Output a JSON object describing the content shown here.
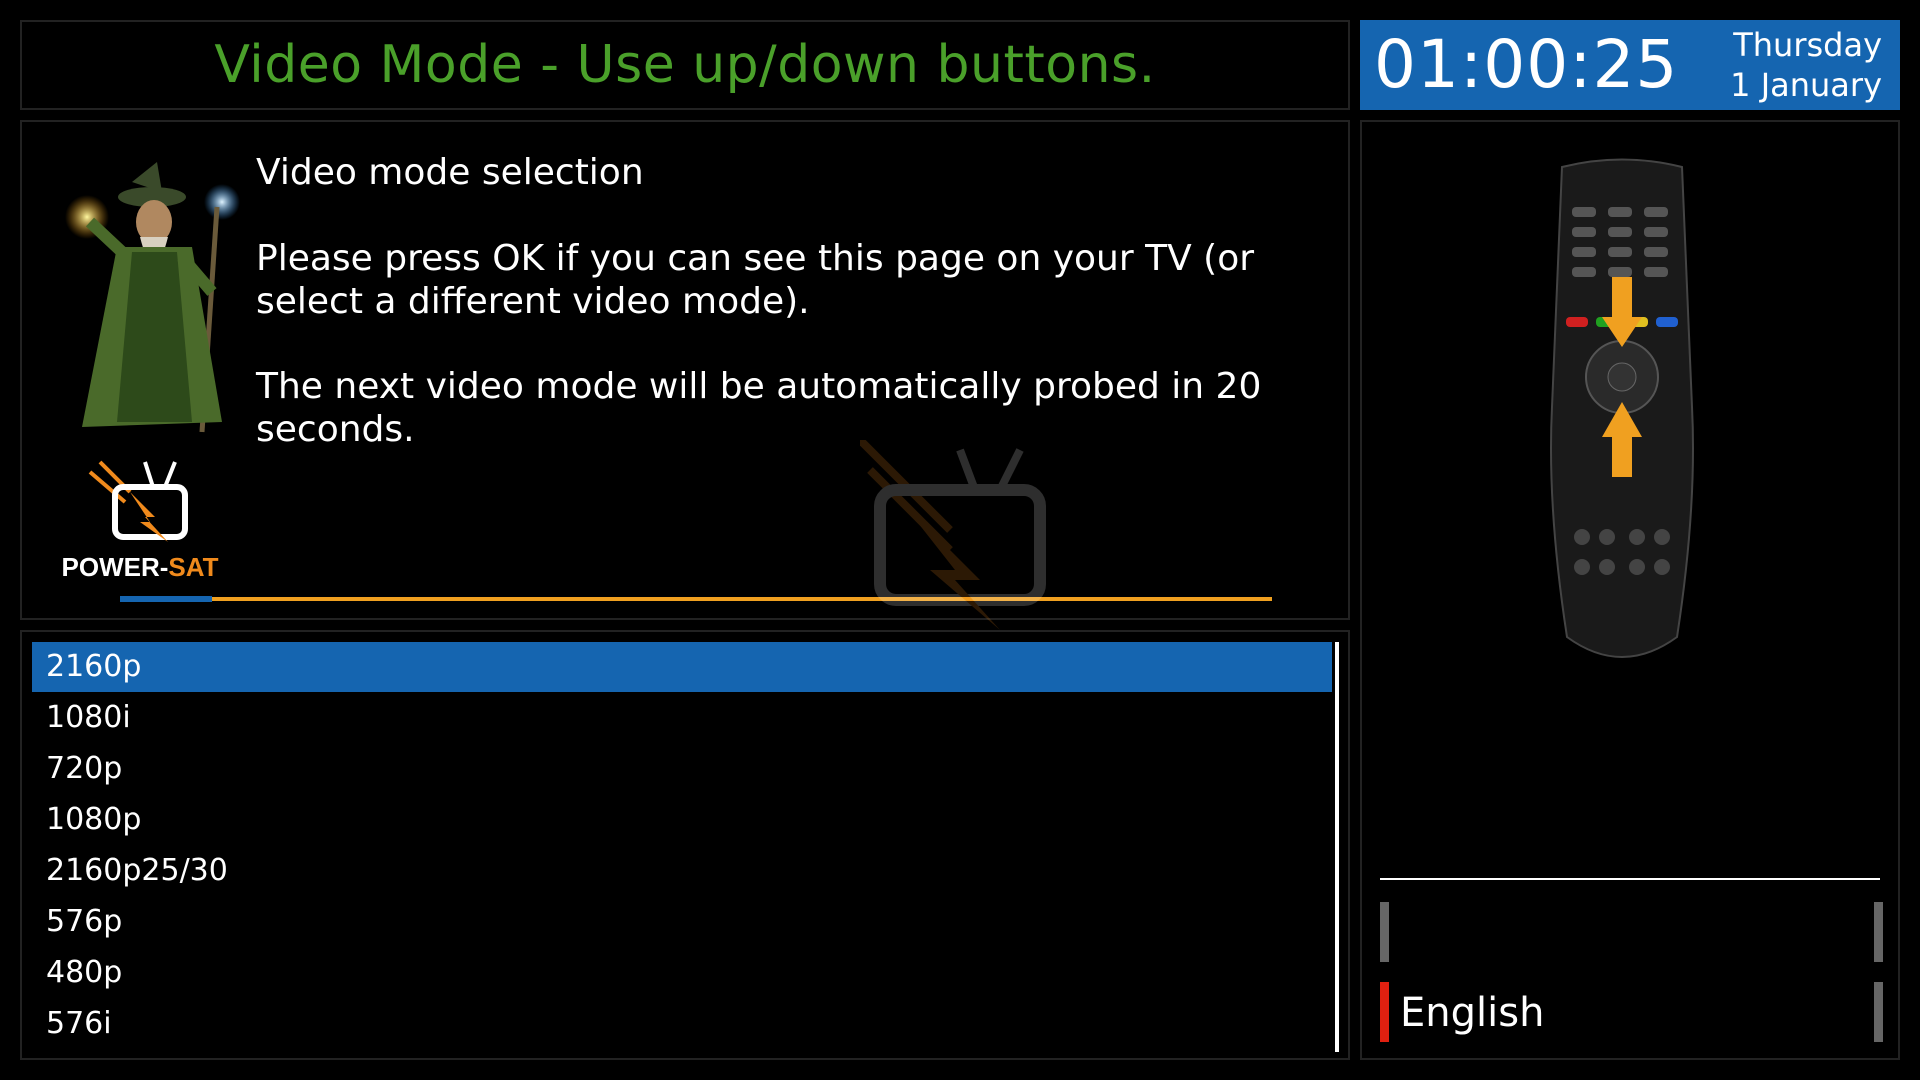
{
  "header": {
    "title": "Video Mode - Use up/down buttons."
  },
  "clock": {
    "time": "01:00:25",
    "day": "Thursday",
    "date": "1 January"
  },
  "info": {
    "heading": "Video mode selection",
    "paragraph1": "Please press OK if you can see this page on your TV (or select a different video mode).",
    "paragraph2": "The next video mode will be automatically probed in 20 seconds.",
    "countdown_progress": 0.08
  },
  "logo": {
    "brand_part1": "POWER-",
    "brand_part2": "SAT"
  },
  "video_modes": {
    "items": [
      "2160p",
      "1080i",
      "720p",
      "1080p",
      "2160p25/30",
      "576p",
      "480p",
      "576i"
    ],
    "selected_index": 0
  },
  "sidebar": {
    "language": "English"
  },
  "colors": {
    "accent_blue": "#1565b0",
    "title_green": "#4aa02a",
    "progress_orange": "#f0a020",
    "language_marker_red": "#e02010"
  }
}
